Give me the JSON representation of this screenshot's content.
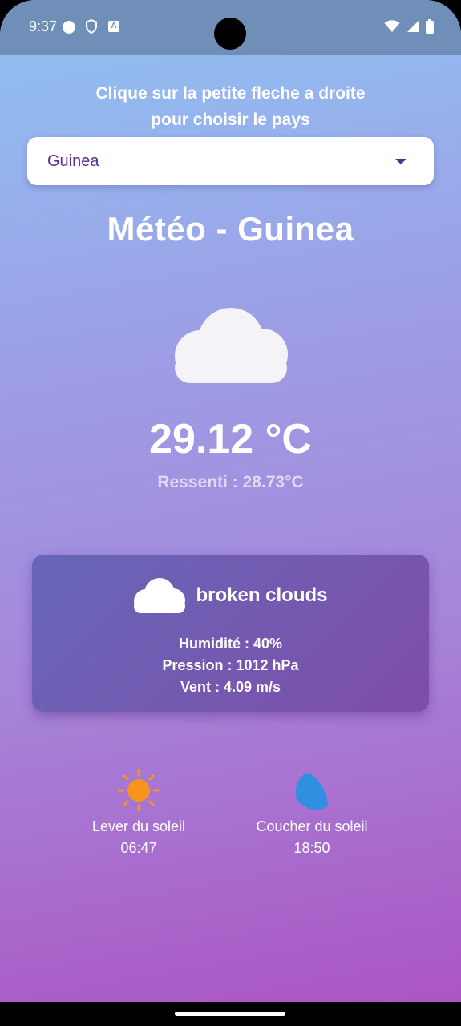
{
  "status_bar": {
    "time": "9:37",
    "badge_letter": "A"
  },
  "instruction": {
    "line1": "Clique sur la petite fleche a droite",
    "line2": "pour choisir le pays"
  },
  "country_select": {
    "selected": "Guinea"
  },
  "weather": {
    "title": "Météo - Guinea",
    "main_icon": "cloud-icon",
    "temperature": "29.12 °C",
    "feels_like": "Ressenti : 28.73°C"
  },
  "details_card": {
    "icon": "cloud-icon",
    "description": "broken clouds",
    "humidity": "Humidité : 40%",
    "pressure": "Pression : 1012 hPa",
    "wind": "Vent : 4.09 m/s"
  },
  "sun": {
    "sunrise_label": "Lever du soleil",
    "sunrise_time": "06:47",
    "sunset_label": "Coucher du soleil",
    "sunset_time": "18:50"
  },
  "colors": {
    "gradient_top": "#8fc3f2",
    "gradient_bottom": "#ab55c3",
    "status_bar": "#6f8fb8",
    "accent": "#5a2d91",
    "sun": "#f7941d",
    "moon": "#2f8fe0"
  }
}
